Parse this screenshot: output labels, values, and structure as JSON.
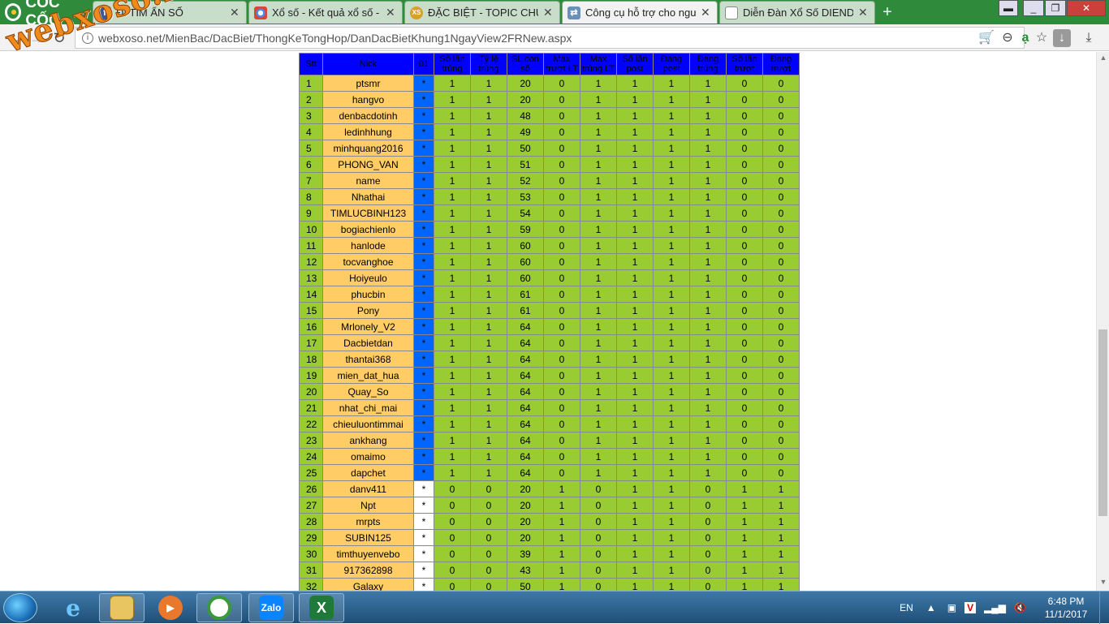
{
  "browser": {
    "brand": "CỐC CỐC",
    "tabs": [
      {
        "label": "ĐI TÌM ẨN SỐ",
        "icon": "facebook-icon",
        "color": "#3b5998"
      },
      {
        "label": "Xổ số - Kết quả xổ số - Trực",
        "icon": "chrome-icon",
        "color": "#d44"
      },
      {
        "label": "ĐẶC BIỆT - TOPIC CHUYÊN",
        "icon": "xs-icon",
        "color": "#d9a02a"
      },
      {
        "label": "Công cụ hỗ trợ cho người",
        "icon": "webpage-icon",
        "color": "#6a8fb8"
      },
      {
        "label": "Diễn Đàn Xổ Số DIENDAN",
        "icon": "page-icon",
        "color": "#888"
      }
    ],
    "url": "webxoso.net/MienBac/DacBiet/ThongKeTongHop/DanDacBietKhung1NgayView2FRNew.aspx"
  },
  "watermark": "webxoso.net",
  "table": {
    "headers": [
      "Stt",
      "Nick",
      "01",
      "Số lần trúng",
      "Tỷ lệ trúng",
      "SL con số",
      "Max trượt LT",
      "Max trúng LT",
      "Số lần post",
      "Đang post",
      "Đang trúng",
      "Số lần trượt",
      "Đang trượt"
    ],
    "rows": [
      {
        "stt": "1",
        "nick": "ptsmr",
        "mark": "*",
        "vals": [
          "1",
          "1",
          "20",
          "0",
          "1",
          "1",
          "1",
          "1",
          "0",
          "0"
        ]
      },
      {
        "stt": "2",
        "nick": "hangvo",
        "mark": "*",
        "vals": [
          "1",
          "1",
          "20",
          "0",
          "1",
          "1",
          "1",
          "1",
          "0",
          "0"
        ]
      },
      {
        "stt": "3",
        "nick": "denbacdotinh",
        "mark": "*",
        "vals": [
          "1",
          "1",
          "48",
          "0",
          "1",
          "1",
          "1",
          "1",
          "0",
          "0"
        ]
      },
      {
        "stt": "4",
        "nick": "ledinhhung",
        "mark": "*",
        "vals": [
          "1",
          "1",
          "49",
          "0",
          "1",
          "1",
          "1",
          "1",
          "0",
          "0"
        ]
      },
      {
        "stt": "5",
        "nick": "minhquang2016",
        "mark": "*",
        "vals": [
          "1",
          "1",
          "50",
          "0",
          "1",
          "1",
          "1",
          "1",
          "0",
          "0"
        ]
      },
      {
        "stt": "6",
        "nick": "PHONG_VAN",
        "mark": "*",
        "vals": [
          "1",
          "1",
          "51",
          "0",
          "1",
          "1",
          "1",
          "1",
          "0",
          "0"
        ]
      },
      {
        "stt": "7",
        "nick": "name",
        "mark": "*",
        "vals": [
          "1",
          "1",
          "52",
          "0",
          "1",
          "1",
          "1",
          "1",
          "0",
          "0"
        ]
      },
      {
        "stt": "8",
        "nick": "Nhathai",
        "mark": "*",
        "vals": [
          "1",
          "1",
          "53",
          "0",
          "1",
          "1",
          "1",
          "1",
          "0",
          "0"
        ]
      },
      {
        "stt": "9",
        "nick": "TIMLUCBINH123",
        "mark": "*",
        "vals": [
          "1",
          "1",
          "54",
          "0",
          "1",
          "1",
          "1",
          "1",
          "0",
          "0"
        ]
      },
      {
        "stt": "10",
        "nick": "bogiachienlo",
        "mark": "*",
        "vals": [
          "1",
          "1",
          "59",
          "0",
          "1",
          "1",
          "1",
          "1",
          "0",
          "0"
        ]
      },
      {
        "stt": "11",
        "nick": "hanlode",
        "mark": "*",
        "vals": [
          "1",
          "1",
          "60",
          "0",
          "1",
          "1",
          "1",
          "1",
          "0",
          "0"
        ]
      },
      {
        "stt": "12",
        "nick": "tocvanghoe",
        "mark": "*",
        "vals": [
          "1",
          "1",
          "60",
          "0",
          "1",
          "1",
          "1",
          "1",
          "0",
          "0"
        ]
      },
      {
        "stt": "13",
        "nick": "Hoiyeulo",
        "mark": "*",
        "vals": [
          "1",
          "1",
          "60",
          "0",
          "1",
          "1",
          "1",
          "1",
          "0",
          "0"
        ]
      },
      {
        "stt": "14",
        "nick": "phucbin",
        "mark": "*",
        "vals": [
          "1",
          "1",
          "61",
          "0",
          "1",
          "1",
          "1",
          "1",
          "0",
          "0"
        ]
      },
      {
        "stt": "15",
        "nick": "Pony",
        "mark": "*",
        "vals": [
          "1",
          "1",
          "61",
          "0",
          "1",
          "1",
          "1",
          "1",
          "0",
          "0"
        ]
      },
      {
        "stt": "16",
        "nick": "Mrlonely_V2",
        "mark": "*",
        "vals": [
          "1",
          "1",
          "64",
          "0",
          "1",
          "1",
          "1",
          "1",
          "0",
          "0"
        ]
      },
      {
        "stt": "17",
        "nick": "Dacbietdan",
        "mark": "*",
        "vals": [
          "1",
          "1",
          "64",
          "0",
          "1",
          "1",
          "1",
          "1",
          "0",
          "0"
        ]
      },
      {
        "stt": "18",
        "nick": "thantai368",
        "mark": "*",
        "vals": [
          "1",
          "1",
          "64",
          "0",
          "1",
          "1",
          "1",
          "1",
          "0",
          "0"
        ]
      },
      {
        "stt": "19",
        "nick": "mien_dat_hua",
        "mark": "*",
        "vals": [
          "1",
          "1",
          "64",
          "0",
          "1",
          "1",
          "1",
          "1",
          "0",
          "0"
        ]
      },
      {
        "stt": "20",
        "nick": "Quay_So",
        "mark": "*",
        "vals": [
          "1",
          "1",
          "64",
          "0",
          "1",
          "1",
          "1",
          "1",
          "0",
          "0"
        ]
      },
      {
        "stt": "21",
        "nick": "nhat_chi_mai",
        "mark": "*",
        "vals": [
          "1",
          "1",
          "64",
          "0",
          "1",
          "1",
          "1",
          "1",
          "0",
          "0"
        ]
      },
      {
        "stt": "22",
        "nick": "chieuluontimmai",
        "mark": "*",
        "vals": [
          "1",
          "1",
          "64",
          "0",
          "1",
          "1",
          "1",
          "1",
          "0",
          "0"
        ]
      },
      {
        "stt": "23",
        "nick": "ankhang",
        "mark": "*",
        "vals": [
          "1",
          "1",
          "64",
          "0",
          "1",
          "1",
          "1",
          "1",
          "0",
          "0"
        ]
      },
      {
        "stt": "24",
        "nick": "omaimo",
        "mark": "*",
        "vals": [
          "1",
          "1",
          "64",
          "0",
          "1",
          "1",
          "1",
          "1",
          "0",
          "0"
        ]
      },
      {
        "stt": "25",
        "nick": "dapchet",
        "mark": "*",
        "vals": [
          "1",
          "1",
          "64",
          "0",
          "1",
          "1",
          "1",
          "1",
          "0",
          "0"
        ]
      },
      {
        "stt": "26",
        "nick": "danv411",
        "mark": "*",
        "vals": [
          "0",
          "0",
          "20",
          "1",
          "0",
          "1",
          "1",
          "0",
          "1",
          "1"
        ]
      },
      {
        "stt": "27",
        "nick": "Npt",
        "mark": "*",
        "vals": [
          "0",
          "0",
          "20",
          "1",
          "0",
          "1",
          "1",
          "0",
          "1",
          "1"
        ]
      },
      {
        "stt": "28",
        "nick": "mrpts",
        "mark": "*",
        "vals": [
          "0",
          "0",
          "20",
          "1",
          "0",
          "1",
          "1",
          "0",
          "1",
          "1"
        ]
      },
      {
        "stt": "29",
        "nick": "SUBIN125",
        "mark": "*",
        "vals": [
          "0",
          "0",
          "20",
          "1",
          "0",
          "1",
          "1",
          "0",
          "1",
          "1"
        ]
      },
      {
        "stt": "30",
        "nick": "timthuyenvebo",
        "mark": "*",
        "vals": [
          "0",
          "0",
          "39",
          "1",
          "0",
          "1",
          "1",
          "0",
          "1",
          "1"
        ]
      },
      {
        "stt": "31",
        "nick": "917362898",
        "mark": "*",
        "vals": [
          "0",
          "0",
          "43",
          "1",
          "0",
          "1",
          "1",
          "0",
          "1",
          "1"
        ]
      },
      {
        "stt": "32",
        "nick": "Galaxy",
        "mark": "*",
        "vals": [
          "0",
          "0",
          "50",
          "1",
          "0",
          "1",
          "1",
          "0",
          "1",
          "1"
        ]
      }
    ],
    "highlighted_mark_rows": 25
  },
  "taskbar": {
    "apps": [
      "internet-explorer-icon",
      "file-explorer-icon",
      "media-player-icon",
      "coccoc-icon",
      "zalo-icon",
      "excel-icon"
    ],
    "zalo_label": "Zalo",
    "excel_label": "X",
    "lang": "EN",
    "time": "6:48 PM",
    "date": "11/1/2017"
  },
  "colors": {
    "green": "#99cc33",
    "orange": "#ffcc66",
    "blue": "#0066ff",
    "header": "#0000ff"
  }
}
